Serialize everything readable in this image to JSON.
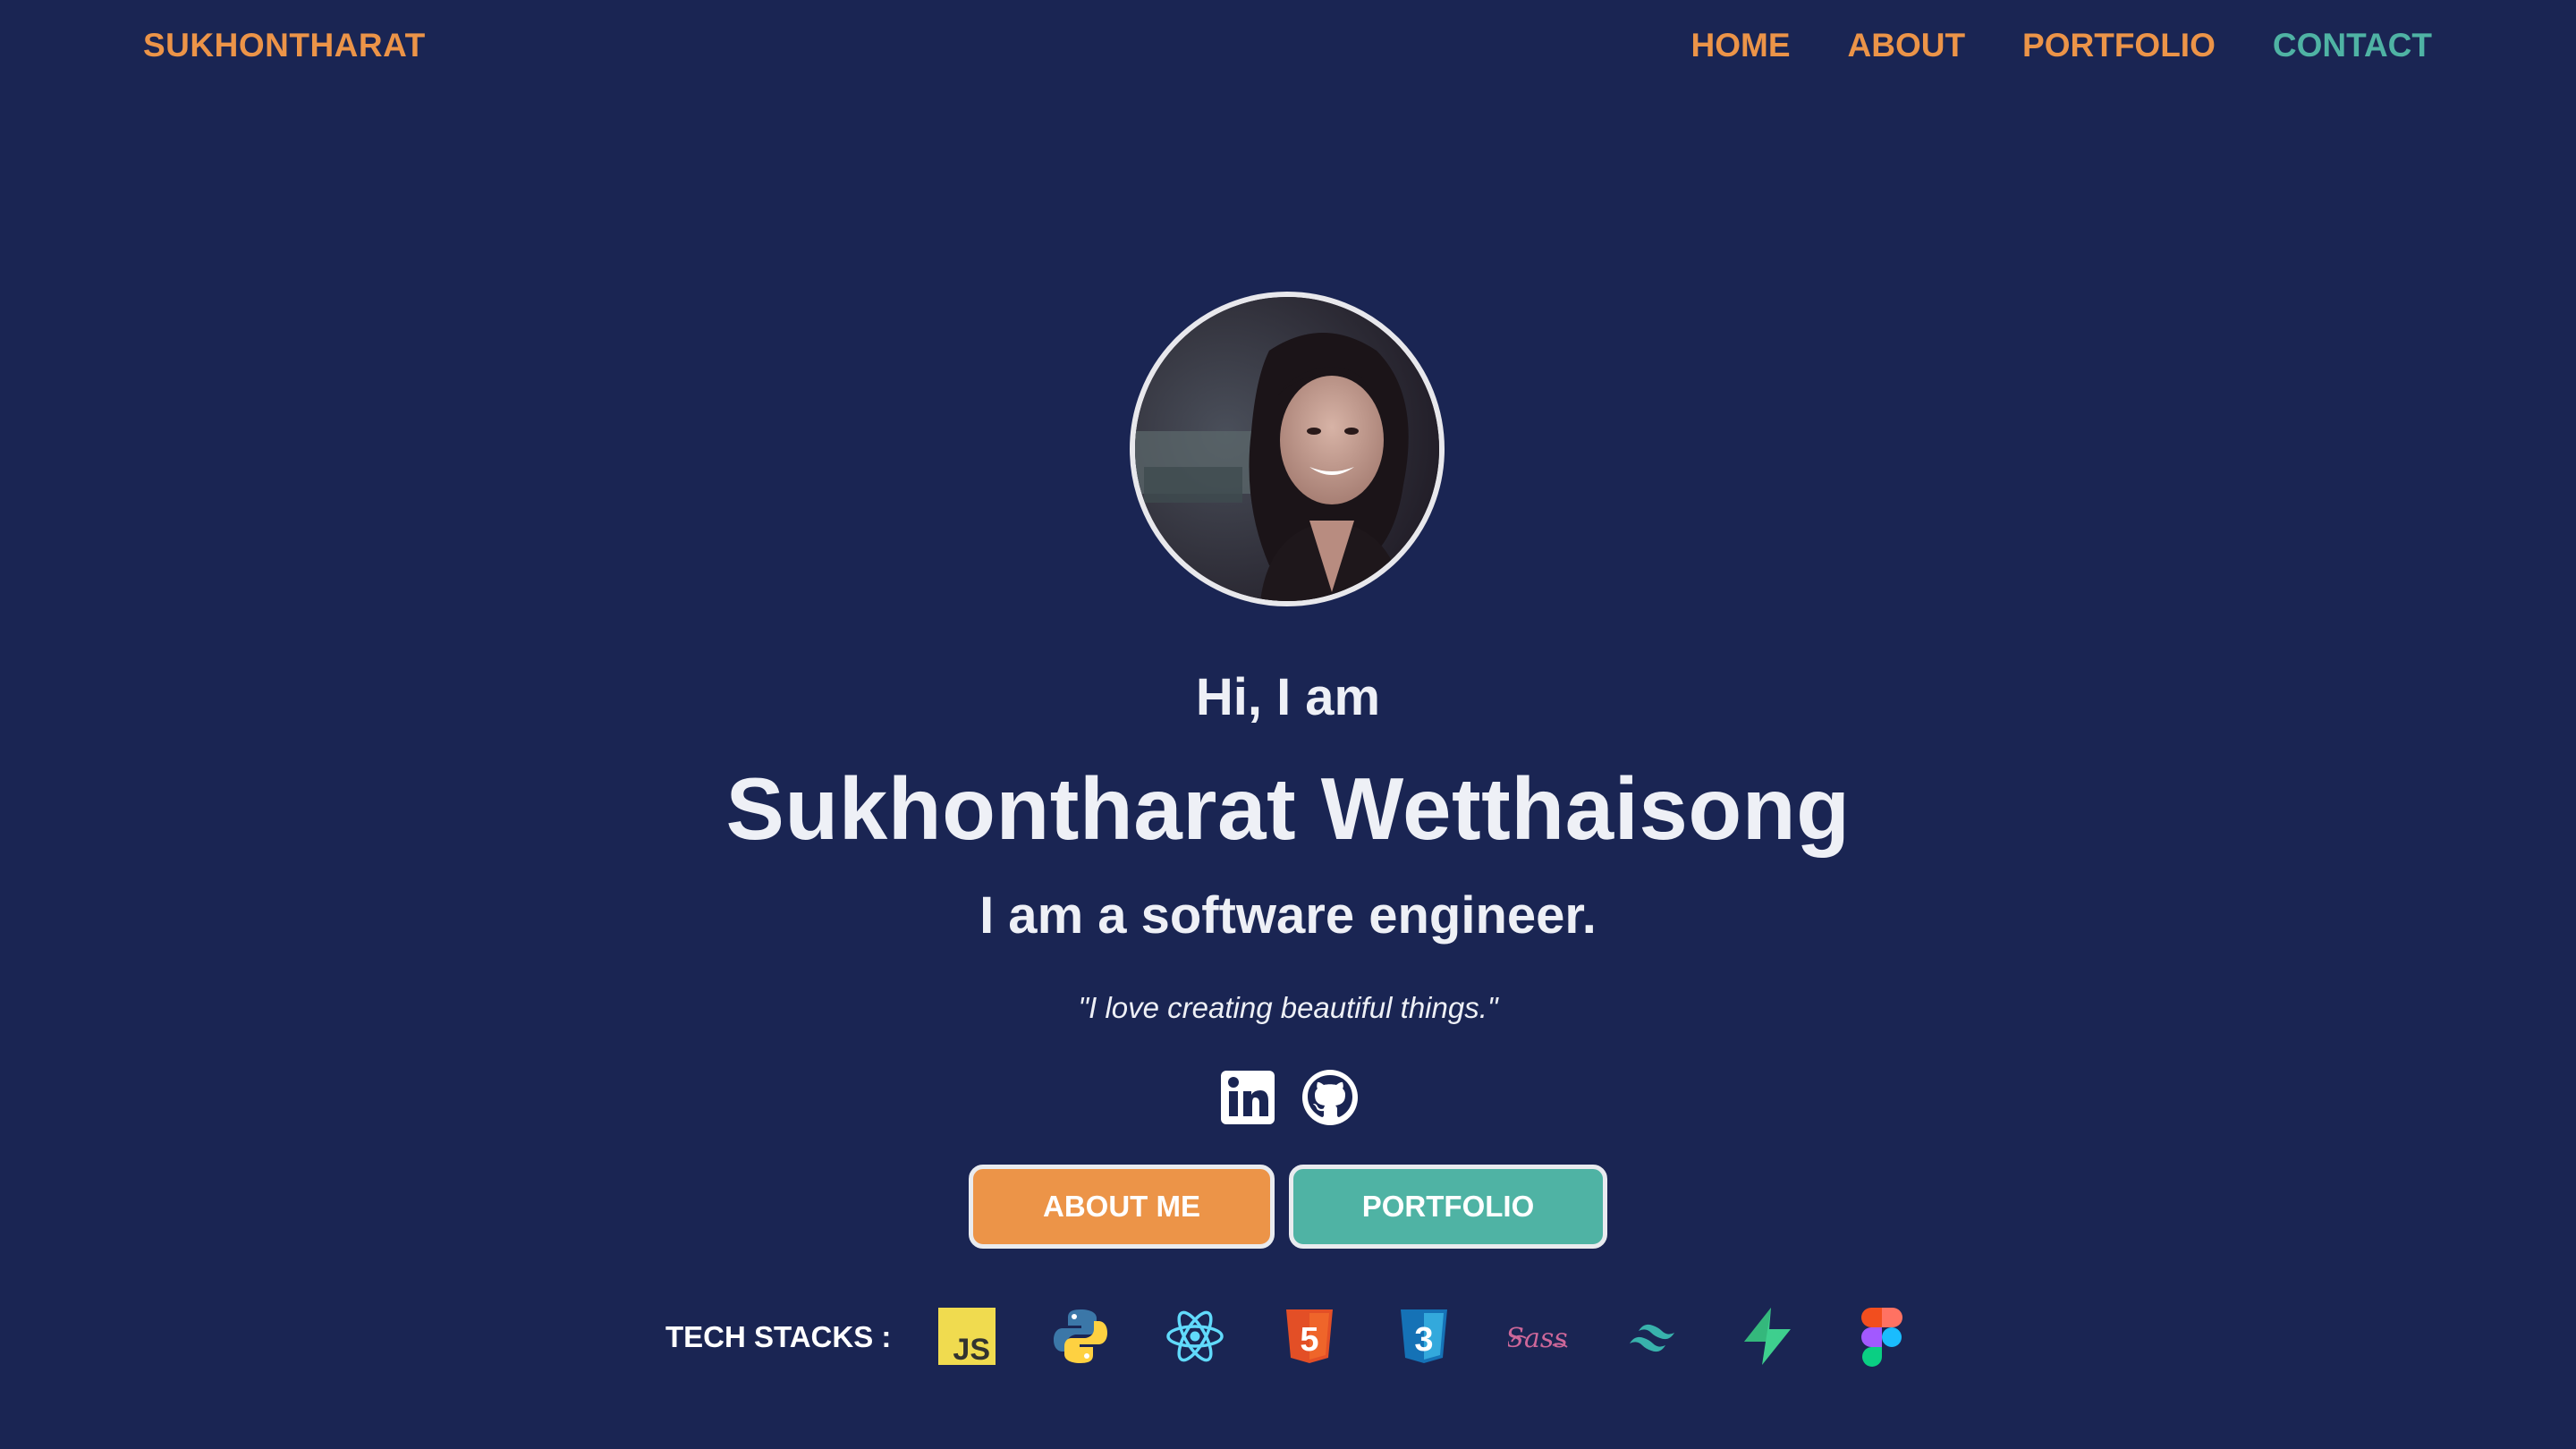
{
  "header": {
    "brand": "SUKHONTHARAT",
    "nav": [
      {
        "label": "HOME"
      },
      {
        "label": "ABOUT"
      },
      {
        "label": "PORTFOLIO"
      },
      {
        "label": "CONTACT",
        "active": true
      }
    ]
  },
  "hero": {
    "greeting": "Hi, I am",
    "name": "Sukhontharat Wetthaisong",
    "role": "I am a software engineer.",
    "quote": "\"I love creating beautiful things.\"",
    "socials": [
      "linkedin-icon",
      "github-icon"
    ],
    "buttons": {
      "about": "ABOUT ME",
      "portfolio": "PORTFOLIO"
    }
  },
  "tech": {
    "label": "TECH STACKS :",
    "icons": [
      "javascript-icon",
      "python-icon",
      "react-icon",
      "html5-icon",
      "css3-icon",
      "sass-icon",
      "tailwind-icon",
      "supabase-icon",
      "figma-icon"
    ],
    "js_text": "JS",
    "html_text": "5",
    "css_text": "3",
    "sass_text": "Sass"
  },
  "colors": {
    "background": "#1a2553",
    "accent_orange": "#ec9448",
    "accent_teal": "#4fb3a4",
    "text": "#eef0f6"
  }
}
